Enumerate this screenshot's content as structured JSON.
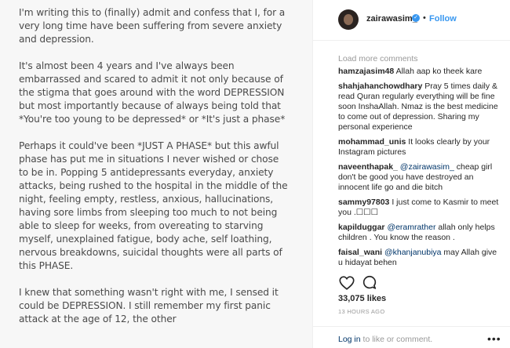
{
  "post": {
    "paragraphs": [
      "I'm writing this to (finally) admit and confess that I, for a very long time have been suffering from severe anxiety and depression.",
      "It's almost been 4 years and I've always been embarrassed and scared to admit it not only because of the stigma that goes around with the word DEPRESSION but most importantly because of always being told that *You're too young to be depressed* or *It's just a phase*",
      "Perhaps it could've been *JUST A PHASE* but this awful phase has put me in situations I never wished or chose to be in. Popping 5 antidepressants everyday, anxiety attacks, being rushed to the hospital in the middle of the night, feeling empty, restless, anxious, hallucinations, having sore limbs from sleeping too much to not being able to sleep for weeks, from overeating to starving myself, unexplained fatigue, body ache, self loathing, nervous breakdowns, suicidal thoughts were all parts of this PHASE.",
      "I knew that something wasn't right with me, I sensed it could be DEPRESSION. I still remember my first panic attack at the age of 12, the other"
    ]
  },
  "header": {
    "username": "zairawasim_",
    "verified_glyph": "✓",
    "separator": "•",
    "follow_label": "Follow"
  },
  "load_more_label": "Load more comments",
  "comments": [
    {
      "user": "hamzajasim48",
      "text": "Allah aap ko theek kare"
    },
    {
      "user": "shahjahanchowdhary",
      "text": "Pray 5 times daily & read Quran regularly everything will be fine soon InshaAllah. Nmaz is the best medicine to come out of depression. Sharing my personal experience"
    },
    {
      "user": "mohammad_unis",
      "text": "It looks clearly by your Instagram pictures"
    },
    {
      "user": "naveenthapak_",
      "mention": "@zairawasim_",
      "text": "cheap girl don't be good you have destroyed an innocent life go and die bitch"
    },
    {
      "user": "sammy97803",
      "text": "I just come to Kasmir to meet you .☐☐☐"
    },
    {
      "user": "kapilduggar",
      "mention": "@eramrather",
      "text": "allah only helps children . You know the reason ."
    },
    {
      "user": "faisal_wani",
      "mention": "@khanjanubiya",
      "text": "may Allah give u hidayat behen"
    }
  ],
  "actions": {
    "like_icon": "heart-outline-icon",
    "comment_icon": "comment-bubble-icon"
  },
  "likes_text": "33,075 likes",
  "timestamp": "13 HOURS AGO",
  "footer": {
    "login_link": "Log in",
    "login_rest": " to like or comment.",
    "more_glyph": "•••"
  },
  "colors": {
    "accent": "#3897f0",
    "link": "#003569",
    "muted": "#999999",
    "text": "#262626"
  }
}
